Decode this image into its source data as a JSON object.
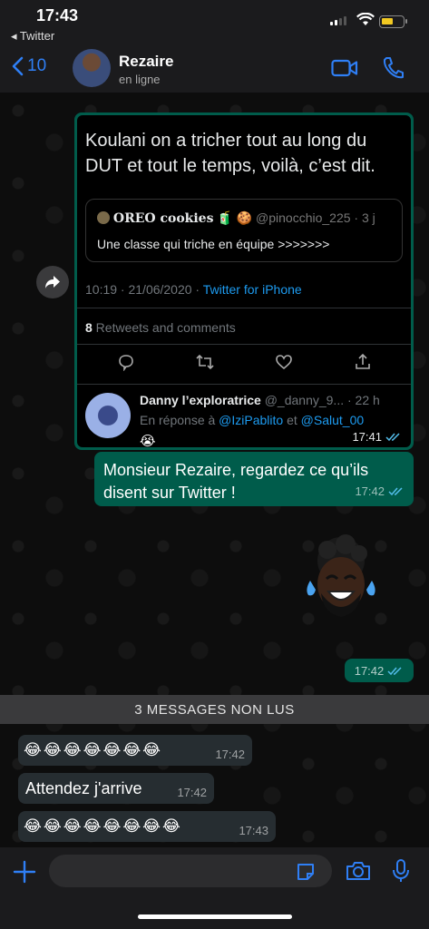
{
  "status_bar": {
    "time": "17:43",
    "back_app": "◂ Twitter"
  },
  "header": {
    "back_count": "10",
    "contact_name": "Rezaire",
    "contact_status": "en ligne"
  },
  "messages": {
    "tweet": {
      "text": "Koulani on a tricher tout au long du DUT et tout le temps, voilà, c’est dit.",
      "quote_name": "OREO cookies",
      "quote_emoji": "🧃 🍪",
      "quote_handle": "@pinocchio_225 · 3 j",
      "quote_text": "Une classe qui triche en équipe >>>>>>>",
      "date": "10:19 · 21/06/2020 · ",
      "source": "Twitter for iPhone",
      "retweet_count": "8",
      "retweet_label": " Retweets and comments",
      "reply_name": "Danny l’exploratrice",
      "reply_handle": " @_danny_9... · 22 h",
      "reply_prefix": "En réponse à ",
      "reply_mention1": "@IziPablito",
      "reply_and": " et ",
      "reply_mention2": "@Salut_00",
      "reply_emojis": "😭😭😭😭",
      "time": "17:41"
    },
    "outgoing_text": {
      "text": "Monsieur Rezaire, regardez ce qu’ils disent sur Twitter !",
      "time": "17:42"
    },
    "sticker_time": "17:42",
    "unread_banner": "3 MESSAGES NON LUS",
    "incoming": [
      {
        "text": "😂😂😂😂😂😂😂",
        "time": "17:42"
      },
      {
        "text": "Attendez j'arrive",
        "time": "17:42"
      },
      {
        "text": "😂😂😂😂😂😂😂😂",
        "time": "17:43"
      }
    ]
  },
  "colors": {
    "accent_blue": "#2f7ff5",
    "outgoing_bubble": "#005c4b",
    "incoming_bubble": "#262d31",
    "twitter_blue": "#1d9bf0"
  },
  "icons": [
    "chevron-left-icon",
    "video-call-icon",
    "phone-call-icon",
    "forward-icon",
    "reply-icon",
    "retweet-icon",
    "like-icon",
    "share-icon",
    "double-check-icon",
    "plus-icon",
    "sticker-icon",
    "camera-icon",
    "microphone-icon"
  ]
}
